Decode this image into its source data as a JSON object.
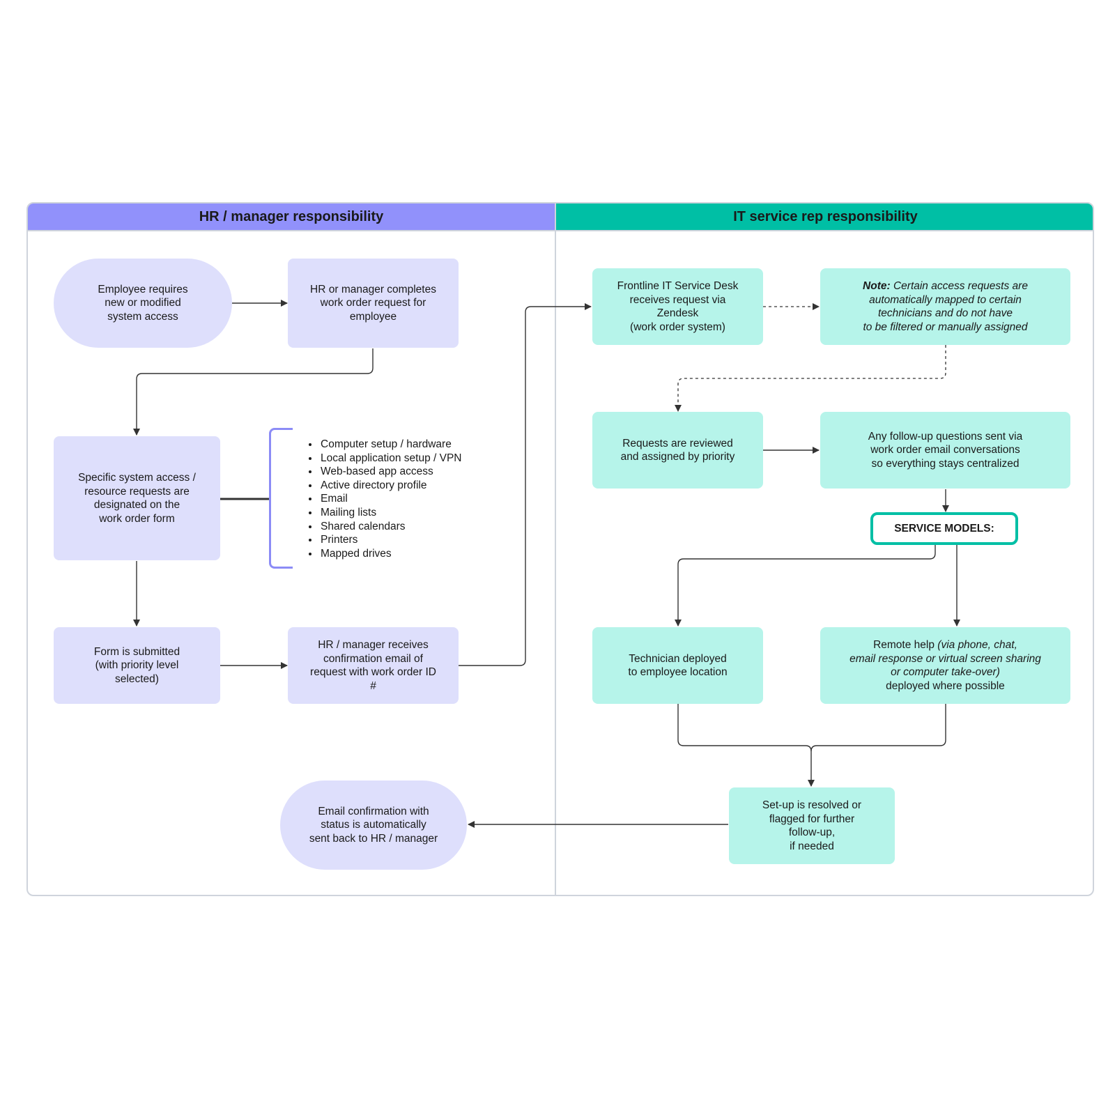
{
  "lanes": {
    "hr": {
      "title": "HR / manager responsibility",
      "color": "#9191fb"
    },
    "it": {
      "title": "IT service rep responsibility",
      "color": "#00bfa5"
    }
  },
  "colors": {
    "hr_node": "#dedffc",
    "it_node": "#b6f4ea",
    "bracket": "#8c8cf6",
    "connector": "#333333"
  },
  "nodes": {
    "employee_requires": "Employee requires\nnew or modified\nsystem access",
    "hr_completes": "HR or manager completes\nwork order request for\nemployee",
    "specific_access": "Specific system access /\nresource requests are\ndesignated on the\nwork order form",
    "form_submitted": "Form is submitted\n(with priority level\nselected)",
    "hr_receives": "HR / manager receives\nconfirmation email of\nrequest with work order ID\n#",
    "frontline": "Frontline IT Service Desk\nreceives request via\nZendesk\n(work order system)",
    "note": {
      "label": "Note:",
      "text_line1": " Certain access requests are",
      "text_rest": "automatically mapped to certain\ntechnicians and do not have\nto be filtered or manually assigned"
    },
    "reviewed": "Requests are reviewed\nand assigned by priority",
    "followup": "Any follow-up questions sent via\nwork order email conversations\nso everything stays centralized",
    "service_models": "SERVICE MODELS:",
    "technician": "Technician deployed\nto employee location",
    "remote": {
      "prefix": "Remote help ",
      "italic": "(via phone, chat,\nemail response or virtual screen sharing\nor computer take-over)",
      "suffix": "\ndeployed where possible"
    },
    "resolved": "Set-up is resolved or\nflagged for further\nfollow-up,\nif needed",
    "email_confirmation": "Email confirmation with\nstatus is automatically\nsent back to HR / manager"
  },
  "resource_list": [
    "Computer setup / hardware",
    "Local application setup / VPN",
    "Web-based app access",
    "Active directory profile",
    "Email",
    "Mailing lists",
    "Shared calendars",
    "Printers",
    "Mapped drives"
  ]
}
